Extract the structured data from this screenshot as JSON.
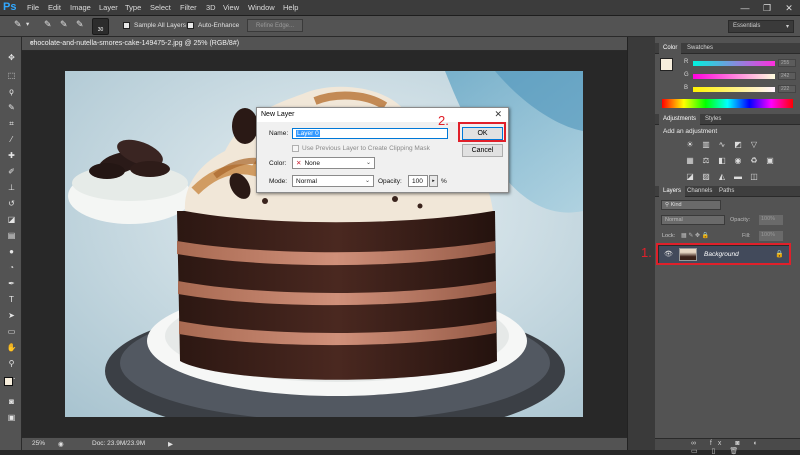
{
  "app": {
    "logo": "Ps",
    "menu": [
      "File",
      "Edit",
      "Image",
      "Layer",
      "Type",
      "Select",
      "Filter",
      "3D",
      "View",
      "Window",
      "Help"
    ]
  },
  "window_controls": {
    "minimize": "—",
    "restore": "❐",
    "close": "✕"
  },
  "options": {
    "brush_size": "30",
    "sample_all_layers": "Sample All Layers",
    "auto_enhance": "Auto-Enhance",
    "refine_edge": "Refine Edge...",
    "workspace": "Essentials"
  },
  "document": {
    "tab_title": "chocolate-and-nutella-smores-cake-149475-2.jpg @ 25% (RGB/8#)",
    "close": "×"
  },
  "status": {
    "zoom": "25%",
    "doc_size": "Doc: 23.9M/23.9M"
  },
  "dialog": {
    "title": "New Layer",
    "close": "✕",
    "name_label": "Name:",
    "name_value": "Layer 0",
    "clipping_mask_label": "Use Previous Layer to Create Clipping Mask",
    "color_label": "Color:",
    "color_value": "None",
    "mode_label": "Mode:",
    "mode_value": "Normal",
    "opacity_label": "Opacity:",
    "opacity_value": "100",
    "opacity_unit": "%",
    "ok": "OK",
    "cancel": "Cancel"
  },
  "annotations": {
    "step1": "1.",
    "step2": "2."
  },
  "panels": {
    "color_tabs": [
      "Color",
      "Swatches"
    ],
    "channels": [
      "R",
      "G",
      "B"
    ],
    "channel_values": [
      "255",
      "242",
      "222"
    ],
    "adj_tabs": [
      "Adjustments",
      "Styles"
    ],
    "adj_title": "Add an adjustment",
    "layers_tabs": [
      "Layers",
      "Channels",
      "Paths"
    ],
    "kind": "Kind",
    "blend": "Normal",
    "opacity_label": "Opacity:",
    "opacity_value": "100%",
    "lock_label": "Lock:",
    "fill_label": "Fill:",
    "fill_value": "100%",
    "layer_name": "Background"
  },
  "colors": {
    "highlight": "#e0202a",
    "fg_swatch": "#f7eedc",
    "selection": "#3399ff"
  }
}
